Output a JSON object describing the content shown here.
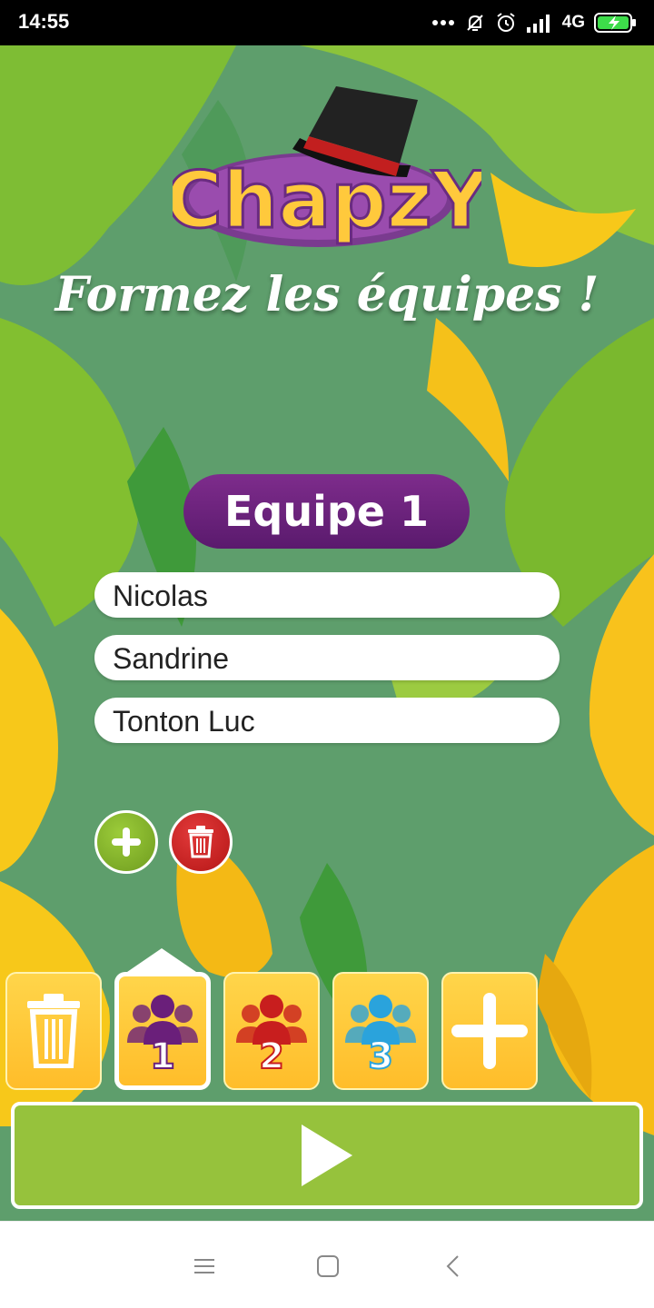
{
  "status_bar": {
    "time": "14:55",
    "network": "4G",
    "icons": [
      "more-dots-icon",
      "muted-bell-icon",
      "alarm-icon",
      "signal-icon",
      "battery-charging-icon"
    ]
  },
  "app": {
    "logo_text": "ChapzY",
    "title": "Formez les équipes !",
    "team_label": "Equipe 1",
    "players": [
      "Nicolas",
      "Sandrine",
      "Tonton Luc"
    ],
    "team_tabs": [
      {
        "kind": "delete",
        "icon": "trash-icon"
      },
      {
        "kind": "team",
        "number": "1",
        "color": "#6a1f7a",
        "active": true
      },
      {
        "kind": "team",
        "number": "2",
        "color": "#c81e1e",
        "active": false
      },
      {
        "kind": "team",
        "number": "3",
        "color": "#2aa3dc",
        "active": false
      },
      {
        "kind": "add",
        "icon": "plus-icon"
      }
    ],
    "play_icon": "play-icon",
    "colors": {
      "primary_purple": "#6a1f7a",
      "accent_yellow": "#ffc93c",
      "play_green": "#96c23c",
      "add_green": "#7fae28",
      "delete_red": "#c81e1e"
    }
  },
  "nav_bar": {
    "icons": [
      "menu-icon",
      "home-square-icon",
      "back-icon"
    ]
  }
}
